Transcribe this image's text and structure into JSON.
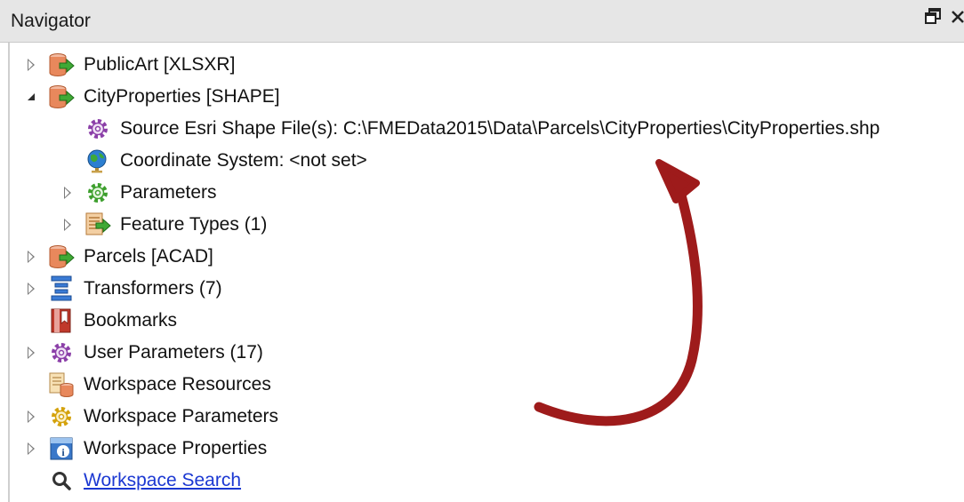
{
  "panel": {
    "title": "Navigator",
    "float_icon": "float-window-icon",
    "close_icon": "close-icon"
  },
  "tree": [
    {
      "label": "PublicArt [XLSXR]",
      "icon": "reader-database-icon",
      "expanded": false,
      "level": 0
    },
    {
      "label": "CityProperties [SHAPE]",
      "icon": "reader-database-icon",
      "expanded": true,
      "level": 0
    },
    {
      "label": "Source Esri Shape File(s): C:\\FMEData2015\\Data\\Parcels\\CityProperties\\CityProperties.shp",
      "icon": "purple-gear-icon",
      "level": 1
    },
    {
      "label": "Coordinate System: <not set>",
      "icon": "globe-icon",
      "level": 1
    },
    {
      "label": "Parameters",
      "icon": "green-gear-icon",
      "expanded": false,
      "level": 1
    },
    {
      "label": "Feature Types (1)",
      "icon": "feature-types-icon",
      "expanded": false,
      "level": 1
    },
    {
      "label": "Parcels [ACAD]",
      "icon": "reader-database-icon",
      "expanded": false,
      "level": 0
    },
    {
      "label": "Transformers (7)",
      "icon": "transformers-icon",
      "expanded": false,
      "level": 0
    },
    {
      "label": "Bookmarks",
      "icon": "bookmark-icon",
      "level": 0
    },
    {
      "label": "User Parameters (17)",
      "icon": "purple-gear-icon",
      "expanded": false,
      "level": 0
    },
    {
      "label": "Workspace Resources",
      "icon": "workspace-resources-icon",
      "level": 0
    },
    {
      "label": "Workspace Parameters",
      "icon": "yellow-gear-icon",
      "expanded": false,
      "level": 0
    },
    {
      "label": "Workspace Properties",
      "icon": "info-icon",
      "expanded": false,
      "level": 0
    },
    {
      "label": "Workspace Search",
      "icon": "magnifier-icon",
      "level": 0,
      "link": true
    }
  ],
  "colors": {
    "annotation_arrow": "#9e1b1b",
    "link": "#1b38d2",
    "header_bg": "#e6e6e6"
  }
}
